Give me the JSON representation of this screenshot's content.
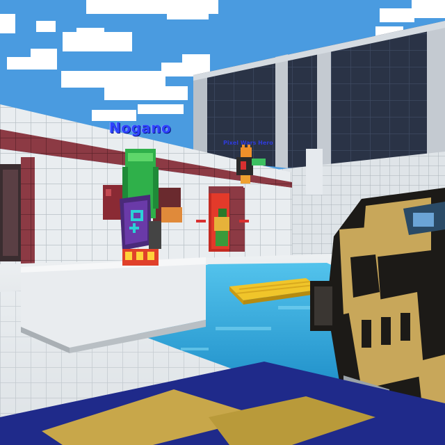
{
  "game": {
    "players": [
      {
        "name": "Nogano"
      },
      {
        "name": "Pixel Wars Hero"
      }
    ]
  },
  "colors": {
    "sky": "#4a9be0",
    "water": "#2ea3d8",
    "tile_white": "#e8ecef",
    "tile_red": "#8c3a44",
    "building_dark": "#2a3346",
    "weapon_gold": "#c8a75a",
    "weapon_dark": "#1c1a17",
    "nametag_blue": "#2e43ff"
  },
  "icons": {
    "floating_raft": "yellow-raft",
    "weapon": "pixel-gun"
  }
}
